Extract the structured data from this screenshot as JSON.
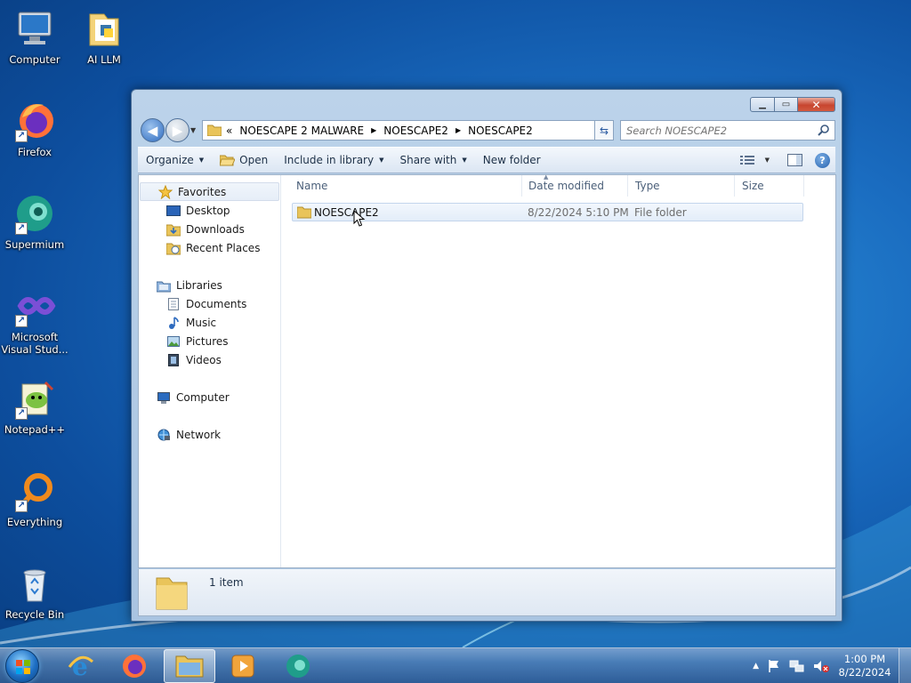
{
  "desktop": {
    "icons": [
      {
        "label": "Computer",
        "icon": "computer-icon"
      },
      {
        "label": "AI LLM",
        "icon": "folder-icon"
      },
      {
        "label": "Firefox",
        "icon": "firefox-icon"
      },
      {
        "label": "Supermium",
        "icon": "supermium-icon"
      },
      {
        "label": "Microsoft\nVisual Stud...",
        "icon": "visual-studio-icon"
      },
      {
        "label": "Notepad++",
        "icon": "notepadpp-icon"
      },
      {
        "label": "Everything",
        "icon": "everything-icon"
      },
      {
        "label": "Recycle Bin",
        "icon": "recycle-bin-icon"
      }
    ]
  },
  "window": {
    "address": {
      "overflow": "«",
      "crumbs": [
        "NOESCAPE 2 MALWARE",
        "NOESCAPE2",
        "NOESCAPE2"
      ]
    },
    "search": {
      "placeholder": "Search NOESCAPE2"
    },
    "toolbar": {
      "organize": "Organize",
      "open": "Open",
      "include": "Include in library",
      "share": "Share with",
      "new_folder": "New folder"
    },
    "nav": {
      "favorites": "Favorites",
      "desktop": "Desktop",
      "downloads": "Downloads",
      "recent": "Recent Places",
      "libraries": "Libraries",
      "documents": "Documents",
      "music": "Music",
      "pictures": "Pictures",
      "videos": "Videos",
      "computer": "Computer",
      "network": "Network"
    },
    "columns": {
      "name": "Name",
      "date": "Date modified",
      "type": "Type",
      "size": "Size"
    },
    "files": [
      {
        "name": "NOESCAPE2",
        "date": "8/22/2024 5:10 PM",
        "type": "File folder",
        "size": ""
      }
    ],
    "details": {
      "count": "1 item"
    }
  },
  "taskbar": {
    "apps": [
      "internet-explorer-icon",
      "firefox-icon",
      "file-explorer-icon",
      "media-player-icon",
      "supermium-icon"
    ],
    "clock": {
      "time": "1:00 PM",
      "date": "8/22/2024"
    }
  },
  "colors": {
    "accent": "#1d6fc4",
    "selection": "#e3edf9"
  }
}
